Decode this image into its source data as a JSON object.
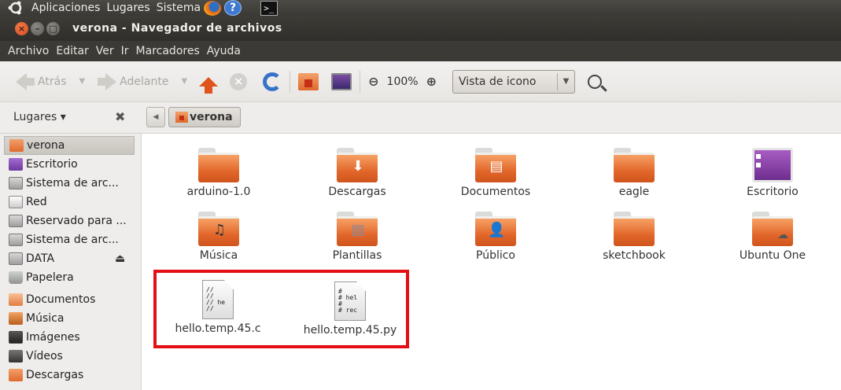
{
  "top_panel": {
    "menus": [
      "Aplicaciones",
      "Lugares",
      "Sistema"
    ],
    "icons": [
      "ubuntu-logo-icon",
      "firefox-icon",
      "help-icon",
      "terminal-icon"
    ]
  },
  "window": {
    "title": "verona - Navegador de archivos"
  },
  "menu_bar": [
    "Archivo",
    "Editar",
    "Ver",
    "Ir",
    "Marcadores",
    "Ayuda"
  ],
  "toolbar": {
    "back_label": "Atrás",
    "forward_label": "Adelante",
    "zoom_level": "100%",
    "view_mode": "Vista de icono"
  },
  "location": {
    "places_label": "Lugares ▾",
    "current_folder": "verona"
  },
  "sidebar": {
    "items": [
      {
        "label": "verona",
        "icon": "home-icon",
        "selected": true
      },
      {
        "label": "Escritorio",
        "icon": "desktop-icon"
      },
      {
        "label": "Sistema de arc...",
        "icon": "drive-icon"
      },
      {
        "label": "Red",
        "icon": "network-icon"
      },
      {
        "label": "Reservado para ...",
        "icon": "drive-icon"
      },
      {
        "label": "Sistema de arc...",
        "icon": "drive-icon"
      },
      {
        "label": "DATA",
        "icon": "drive-icon",
        "ejectable": true
      },
      {
        "label": "Papelera",
        "icon": "trash-icon"
      },
      {
        "label": "Documentos",
        "icon": "documents-icon"
      },
      {
        "label": "Música",
        "icon": "music-icon"
      },
      {
        "label": "Imágenes",
        "icon": "images-icon"
      },
      {
        "label": "Vídeos",
        "icon": "videos-icon"
      },
      {
        "label": "Descargas",
        "icon": "downloads-icon"
      }
    ]
  },
  "content": {
    "folders": [
      {
        "name": "arduino-1.0",
        "icon": "folder-icon"
      },
      {
        "name": "Descargas",
        "icon": "downloads-folder-icon"
      },
      {
        "name": "Documentos",
        "icon": "documents-folder-icon"
      },
      {
        "name": "eagle",
        "icon": "folder-icon"
      },
      {
        "name": "Escritorio",
        "icon": "desktop-folder-icon"
      },
      {
        "name": "Música",
        "icon": "music-folder-icon"
      },
      {
        "name": "Plantillas",
        "icon": "templates-folder-icon"
      },
      {
        "name": "Público",
        "icon": "public-folder-icon"
      },
      {
        "name": "sketchbook",
        "icon": "folder-icon"
      },
      {
        "name": "Ubuntu One",
        "icon": "ubuntu-one-folder-icon"
      }
    ],
    "files": [
      {
        "name": "hello.temp.45.c",
        "preview": "//\n//\n// he\n//"
      },
      {
        "name": "hello.temp.45.py",
        "preview": "#\n# hel\n#\n# rec"
      }
    ],
    "highlight_color": "#e40e14"
  }
}
